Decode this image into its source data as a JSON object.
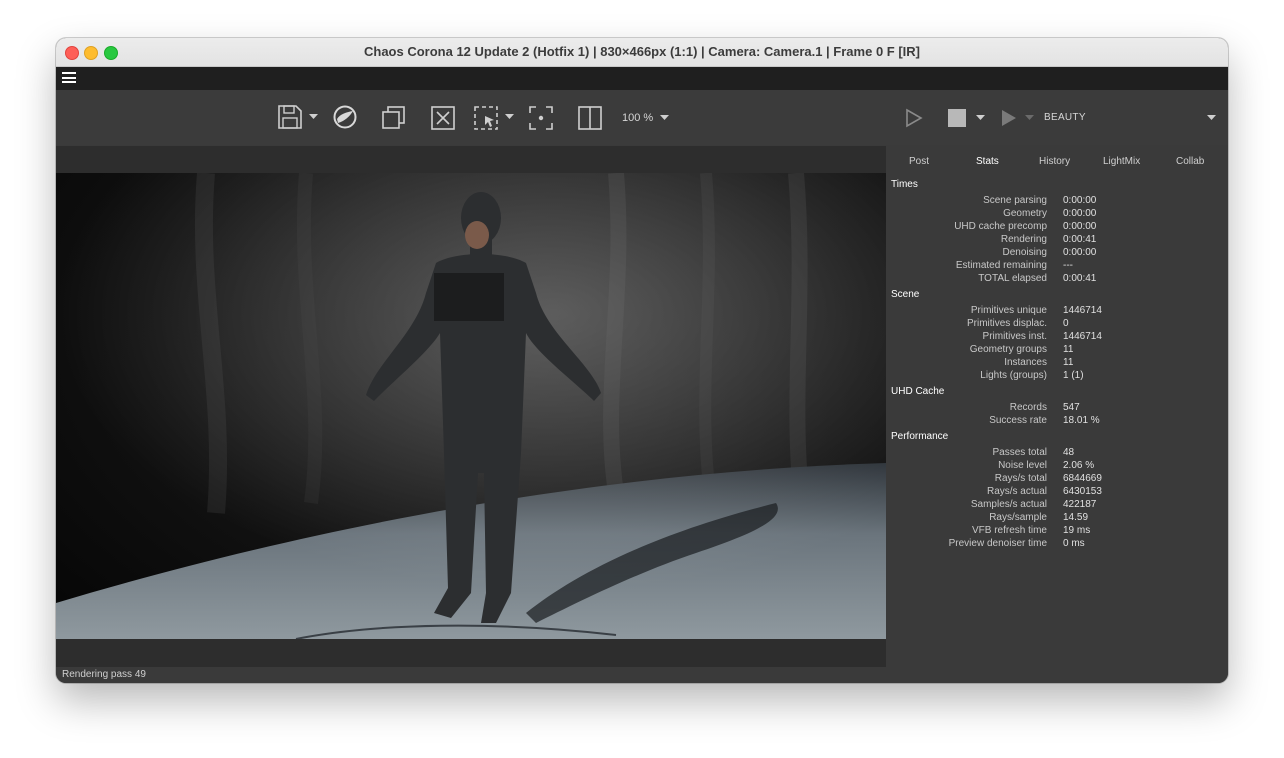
{
  "window": {
    "title": "Chaos Corona 12 Update 2 (Hotfix 1) | 830×466px (1:1) | Camera: Camera.1 | Frame 0 F [IR]"
  },
  "toolbar": {
    "zoom_label": "100 %",
    "render_element": "BEAUTY"
  },
  "tabs": [
    {
      "label": "Post"
    },
    {
      "label": "Stats"
    },
    {
      "label": "History"
    },
    {
      "label": "LightMix"
    },
    {
      "label": "Collab"
    }
  ],
  "stats": {
    "times": {
      "heading": "Times",
      "rows": [
        {
          "label": "Scene parsing",
          "value": "0:00:00"
        },
        {
          "label": "Geometry",
          "value": "0:00:00"
        },
        {
          "label": "UHD cache precomp",
          "value": "0:00:00"
        },
        {
          "label": "Rendering",
          "value": "0:00:41"
        },
        {
          "label": "Denoising",
          "value": "0:00:00"
        },
        {
          "label": "Estimated remaining",
          "value": "---"
        },
        {
          "label": "TOTAL elapsed",
          "value": "0:00:41"
        }
      ]
    },
    "scene": {
      "heading": "Scene",
      "rows": [
        {
          "label": "Primitives unique",
          "value": "1446714"
        },
        {
          "label": "Primitives displac.",
          "value": "0"
        },
        {
          "label": "Primitives inst.",
          "value": "1446714"
        },
        {
          "label": "Geometry groups",
          "value": "11"
        },
        {
          "label": "Instances",
          "value": "11"
        },
        {
          "label": "Lights (groups)",
          "value": "1 (1)"
        }
      ]
    },
    "uhd": {
      "heading": "UHD Cache",
      "rows": [
        {
          "label": "Records",
          "value": "547"
        },
        {
          "label": "Success rate",
          "value": "18.01 %"
        }
      ]
    },
    "performance": {
      "heading": "Performance",
      "rows": [
        {
          "label": "Passes total",
          "value": "48"
        },
        {
          "label": "Noise level",
          "value": "2.06 %"
        },
        {
          "label": "Rays/s total",
          "value": "6844669"
        },
        {
          "label": "Rays/s actual",
          "value": "6430153"
        },
        {
          "label": "Samples/s actual",
          "value": "422187"
        },
        {
          "label": "Rays/sample",
          "value": "14.59"
        },
        {
          "label": "VFB refresh time",
          "value": "19 ms"
        },
        {
          "label": "Preview denoiser time",
          "value": "0 ms"
        }
      ]
    }
  },
  "status": {
    "text": "Rendering pass 49"
  }
}
